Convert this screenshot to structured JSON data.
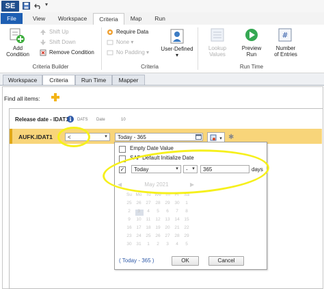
{
  "quick_access": {
    "logo": "SE"
  },
  "ribbon_tabs": [
    "File",
    "View",
    "Workspace",
    "Criteria",
    "Map",
    "Run"
  ],
  "ribbon": {
    "criteria_builder": {
      "add_condition": "Add\nCondition",
      "shift_up": "Shift Up",
      "shift_down": "Shift Down",
      "remove_condition": "Remove Condition",
      "group_label": "Criteria Builder"
    },
    "criteria": {
      "require_data": "Require Data",
      "none": "None",
      "no_padding": "No Padding",
      "user_defined": "User-Defined",
      "group_label": "Criteria"
    },
    "run_time": {
      "lookup_values": "Lookup\nValues",
      "preview_run": "Preview\nRun",
      "number_of_entries": "Number\nof Entries",
      "group_label": "Run Time"
    }
  },
  "sub_tabs": [
    "Workspace",
    "Criteria",
    "Run Time",
    "Mapper"
  ],
  "find_all_items": "Find all items:",
  "field": {
    "title": "Release date - IDAT1",
    "type": "DATS",
    "kind": "Date",
    "length": "10"
  },
  "criteria_row": {
    "label": "AUFK.IDAT1",
    "operator": "<",
    "value": "Today - 365"
  },
  "popup": {
    "empty_date": "Empty Date Value",
    "sap_default": "SAP Default Initialize Date",
    "relative_base": "Today",
    "relative_sign": "-",
    "relative_amount": "365",
    "relative_unit": "days",
    "month_label": "May 2021",
    "weekdays": [
      "Su",
      "Mo",
      "Tu",
      "We",
      "Th",
      "Fr",
      "Sa"
    ],
    "calendar_rows": [
      [
        "25",
        "26",
        "27",
        "28",
        "29",
        "30",
        "1"
      ],
      [
        "2",
        "3",
        "4",
        "5",
        "6",
        "7",
        "8"
      ],
      [
        "9",
        "10",
        "11",
        "12",
        "13",
        "14",
        "15"
      ],
      [
        "16",
        "17",
        "18",
        "19",
        "20",
        "21",
        "22"
      ],
      [
        "23",
        "24",
        "25",
        "26",
        "27",
        "28",
        "29"
      ],
      [
        "30",
        "31",
        "1",
        "2",
        "3",
        "4",
        "5"
      ]
    ],
    "footer_expr": "( Today - 365 )",
    "ok_label": "OK",
    "cancel_label": "Cancel"
  },
  "colors": {
    "file_tab": "#1e5fb3",
    "criteria_row": "#f8d57a",
    "highlight": "#f6f01c"
  }
}
